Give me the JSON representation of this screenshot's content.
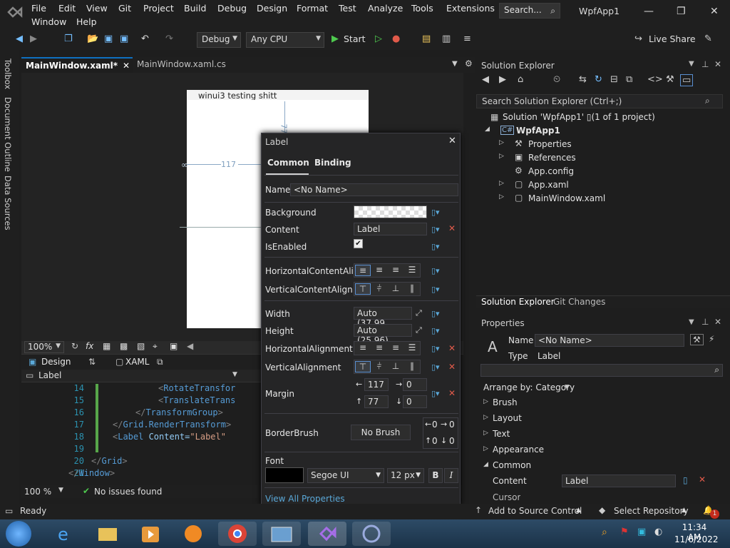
{
  "menu": {
    "row1": [
      "File",
      "Edit",
      "View",
      "Git",
      "Project",
      "Build",
      "Debug",
      "Design",
      "Format",
      "Test",
      "Analyze",
      "Tools",
      "Extensions"
    ],
    "row2": [
      "Window",
      "Help"
    ],
    "search_label": "Search...",
    "app_title": "WpfApp1"
  },
  "toolbar": {
    "config": "Debug",
    "platform": "Any CPU",
    "start": "Start",
    "live_share": "Live Share"
  },
  "left_strip": [
    "Toolbox",
    "Document Outline",
    "Data Sources"
  ],
  "doc_tabs": [
    {
      "label": "MainWindow.xaml*",
      "active": true
    },
    {
      "label": "MainWindow.xaml.cs",
      "active": false
    }
  ],
  "designer": {
    "window_title": "winui3 testing shitt",
    "margin_left": "117",
    "margin_top": "77",
    "zoom": "100%"
  },
  "view_tabs": {
    "design": "Design",
    "xaml": "XAML"
  },
  "breadcrumb": "Label",
  "code": {
    "lines": [
      {
        "num": "14",
        "text": "<RotateTransfor",
        "indent": 222
      },
      {
        "num": "15",
        "text": "<TranslateTrans",
        "indent": 222
      },
      {
        "num": "16",
        "text": "</TransformGroup>",
        "indent": 190
      },
      {
        "num": "17",
        "text": "</Grid.RenderTransform>",
        "indent": 158
      },
      {
        "num": "18",
        "text": "<Label Content=\"Label\" ",
        "indent": 158
      },
      {
        "num": "19",
        "text": "",
        "indent": 158
      },
      {
        "num": "20",
        "text": "</Grid>",
        "indent": 128
      },
      {
        "num": "21",
        "text": "</Window>",
        "indent": 96
      }
    ],
    "zoom": "100 %",
    "issues": "No issues found"
  },
  "status": {
    "ready": "Ready",
    "source_control": "Add to Source Control",
    "repo": "Select Repository",
    "notif_count": "1"
  },
  "taskbar": {
    "time": "11:34 AM",
    "date": "11/6/2022"
  },
  "solution_explorer": {
    "title": "Solution Explorer",
    "search": "Search Solution Explorer (Ctrl+;)",
    "solution": "Solution 'WpfApp1' ▯(1 of 1 project)",
    "project": "WpfApp1",
    "items": [
      "Properties",
      "References",
      "App.config",
      "App.xaml",
      "MainWindow.xaml"
    ],
    "tabs": [
      "Solution Explorer",
      "Git Changes"
    ]
  },
  "properties": {
    "title": "Properties",
    "name_label": "Name",
    "name_value": "<No Name>",
    "type_label": "Type",
    "type_value": "Label",
    "arrange": "Arrange by: Category",
    "categories": [
      "Brush",
      "Layout",
      "Text",
      "Appearance",
      "Common"
    ],
    "content_label": "Content",
    "content_value": "Label",
    "cursor_label": "Cursor"
  },
  "popup": {
    "title": "Label",
    "tab_common": "Common",
    "tab_binding": "Binding",
    "name_label": "Name",
    "name_value": "<No Name>",
    "background": "Background",
    "content": "Content",
    "content_value": "Label",
    "isenabled": "IsEnabled",
    "hca": "HorizontalContentAli...",
    "vca": "VerticalContentAlign...",
    "width": "Width",
    "width_value": "Auto (37.99...",
    "height": "Height",
    "height_value": "Auto (25.96)",
    "ha": "HorizontalAlignment",
    "va": "VerticalAlignment",
    "margin": "Margin",
    "margin_values": [
      "117",
      "0",
      "77",
      "0"
    ],
    "borderbrush": "BorderBrush",
    "borderbrush_value": "No Brush",
    "border_values": [
      "0",
      "0",
      "0",
      "0"
    ],
    "font": "Font",
    "font_family": "Segoe UI",
    "font_size": "12 px",
    "bold": "B",
    "italic": "I",
    "view_all": "View All Properties"
  }
}
